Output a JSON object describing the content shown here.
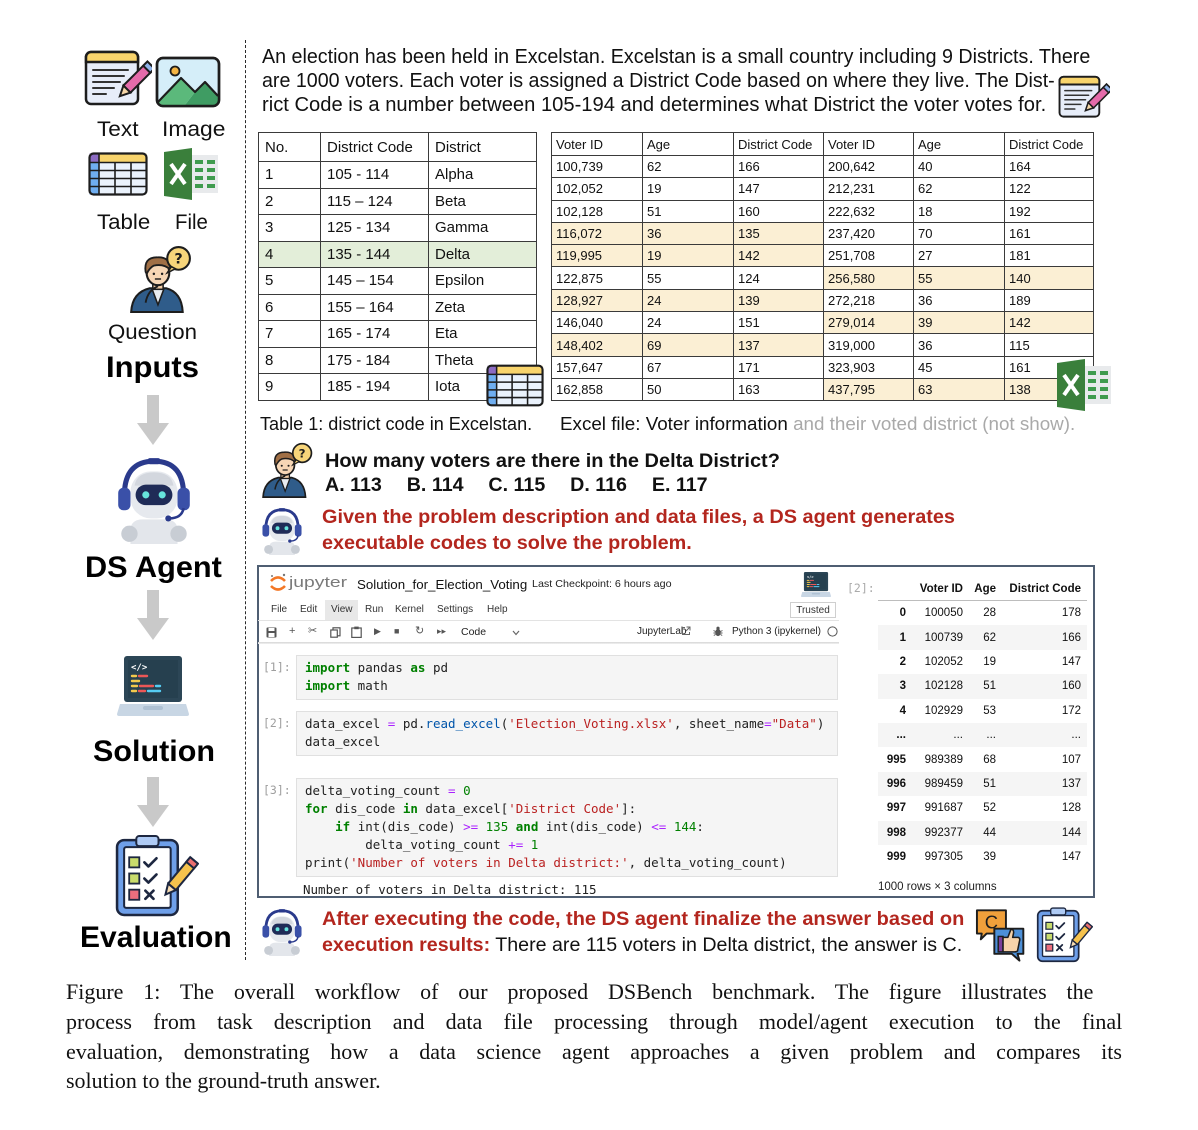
{
  "theme": {
    "accent_red": "#B3261E",
    "highlight_yellow": "#FBEFD4",
    "highlight_green": "#E3EED9",
    "arrow_gray": "#C9C9C9",
    "jupyter_orange": "#F37726"
  },
  "sidebar": {
    "input_types": [
      {
        "label": "Text",
        "icon": "text-icon"
      },
      {
        "label": "Image",
        "icon": "image-icon"
      },
      {
        "label": "Table",
        "icon": "table-icon"
      },
      {
        "label": "File",
        "icon": "excel-file-icon"
      }
    ],
    "question_label": "Question",
    "stages": [
      {
        "label": "Inputs"
      },
      {
        "label": "DS Agent",
        "icon": "robot-icon"
      },
      {
        "label": "Solution",
        "icon": "laptop-code-icon"
      },
      {
        "label": "Evaluation",
        "icon": "checklist-clipboard-icon"
      }
    ]
  },
  "description": {
    "lines": [
      "An election has been held in Excelstan. Excelstan is a small country including 9 Districts. There",
      "are 1000 voters. Each voter is assigned a District Code based on where they live. The Dist-",
      "rict Code is a number between 105-194 and determines what District the voter votes for."
    ]
  },
  "district_table": {
    "headers": [
      "No.",
      "District Code",
      "District"
    ],
    "rows": [
      {
        "no": "1",
        "code": "105 - 114",
        "district": "Alpha",
        "highlight": false
      },
      {
        "no": "2",
        "code": "115 – 124",
        "district": "Beta",
        "highlight": false
      },
      {
        "no": "3",
        "code": "125 - 134",
        "district": "Gamma",
        "highlight": false
      },
      {
        "no": "4",
        "code": "135 - 144",
        "district": "Delta",
        "highlight": true
      },
      {
        "no": "5",
        "code": "145 – 154",
        "district": "Epsilon",
        "highlight": false
      },
      {
        "no": "6",
        "code": "155 – 164",
        "district": "Zeta",
        "highlight": false
      },
      {
        "no": "7",
        "code": "165 - 174",
        "district": "Eta",
        "highlight": false
      },
      {
        "no": "8",
        "code": "175 - 184",
        "district": "Theta",
        "highlight": false
      },
      {
        "no": "9",
        "code": "185 - 194",
        "district": "Iota",
        "highlight": false
      }
    ]
  },
  "voter_file": {
    "headers": [
      "Voter ID",
      "Age",
      "District Code",
      "Voter ID",
      "Age",
      "District Code"
    ],
    "rows": [
      {
        "cells": [
          "100,739",
          "62",
          "166",
          "200,642",
          "40",
          "164"
        ],
        "highlight_left": false,
        "highlight_right": false
      },
      {
        "cells": [
          "102,052",
          "19",
          "147",
          "212,231",
          "62",
          "122"
        ],
        "highlight_left": false,
        "highlight_right": false
      },
      {
        "cells": [
          "102,128",
          "51",
          "160",
          "222,632",
          "18",
          "192"
        ],
        "highlight_left": false,
        "highlight_right": false
      },
      {
        "cells": [
          "116,072",
          "36",
          "135",
          "237,420",
          "70",
          "161"
        ],
        "highlight_left": true,
        "highlight_right": false
      },
      {
        "cells": [
          "119,995",
          "19",
          "142",
          "251,708",
          "27",
          "181"
        ],
        "highlight_left": true,
        "highlight_right": false
      },
      {
        "cells": [
          "122,875",
          "55",
          "124",
          "256,580",
          "55",
          "140"
        ],
        "highlight_left": false,
        "highlight_right": true
      },
      {
        "cells": [
          "128,927",
          "24",
          "139",
          "272,218",
          "36",
          "189"
        ],
        "highlight_left": true,
        "highlight_right": false
      },
      {
        "cells": [
          "146,040",
          "24",
          "151",
          "279,014",
          "39",
          "142"
        ],
        "highlight_left": false,
        "highlight_right": true
      },
      {
        "cells": [
          "148,402",
          "69",
          "137",
          "319,000",
          "36",
          "115"
        ],
        "highlight_left": true,
        "highlight_right": false
      },
      {
        "cells": [
          "157,647",
          "67",
          "171",
          "323,903",
          "45",
          "161"
        ],
        "highlight_left": false,
        "highlight_right": false
      },
      {
        "cells": [
          "162,858",
          "50",
          "163",
          "437,795",
          "63",
          "138"
        ],
        "highlight_left": false,
        "highlight_right": true
      }
    ]
  },
  "captions": {
    "table": "Table 1: district code in Excelstan.",
    "file_visible": "Excel file: Voter information",
    "file_hidden": " and their voted district (not show)."
  },
  "question": {
    "text": "How many voters are there in the Delta District?",
    "options": [
      "A. 113",
      "B. 114",
      "C. 115",
      "D. 116",
      "E. 117"
    ]
  },
  "agent_step": {
    "lines": [
      "Given the problem description and data files, a DS agent generates",
      "executable codes to solve the problem."
    ]
  },
  "jupyter": {
    "logo_text": "jupyter",
    "notebook_name": "Solution_for_Election_Voting",
    "checkpoint": "Last Checkpoint: 6 hours ago",
    "menu": [
      "File",
      "Edit",
      "View",
      "Run",
      "Kernel",
      "Settings",
      "Help"
    ],
    "active_menu": "View",
    "trusted": "Trusted",
    "toolbar": {
      "add": "+",
      "cut": "✂",
      "run": "▶",
      "stop": "■",
      "restart": "↻",
      "run_all": "▸▸",
      "cell_type": "Code",
      "lab_link": "JupyterLab",
      "kernel": "Python 3 (ipykernel)"
    },
    "cells": [
      {
        "prompt": "[1]:",
        "lines": [
          [
            {
              "text": "import",
              "type": "kw"
            },
            {
              "text": " pandas ",
              "type": "plain"
            },
            {
              "text": "as",
              "type": "kw"
            },
            {
              "text": " pd",
              "type": "plain"
            }
          ],
          [
            {
              "text": "import",
              "type": "kw"
            },
            {
              "text": " math",
              "type": "plain"
            }
          ]
        ]
      },
      {
        "prompt": "[2]:",
        "lines": [
          [
            {
              "text": "data_excel ",
              "type": "plain"
            },
            {
              "text": "=",
              "type": "op"
            },
            {
              "text": " pd.",
              "type": "plain"
            },
            {
              "text": "read_excel",
              "type": "fn"
            },
            {
              "text": "(",
              "type": "plain"
            },
            {
              "text": "'Election_Voting.xlsx'",
              "type": "str"
            },
            {
              "text": ", sheet_name",
              "type": "plain"
            },
            {
              "text": "=",
              "type": "op"
            },
            {
              "text": "\"Data\"",
              "type": "str"
            },
            {
              "text": ")",
              "type": "plain"
            }
          ],
          [
            {
              "text": "data_excel",
              "type": "plain"
            }
          ]
        ]
      },
      {
        "prompt": "[3]:",
        "lines": [
          [
            {
              "text": "delta_voting_count ",
              "type": "plain"
            },
            {
              "text": "=",
              "type": "op"
            },
            {
              "text": " ",
              "type": "plain"
            },
            {
              "text": "0",
              "type": "num"
            }
          ],
          [
            {
              "text": "for",
              "type": "kw"
            },
            {
              "text": " dis_code ",
              "type": "plain"
            },
            {
              "text": "in",
              "type": "kw"
            },
            {
              "text": " data_excel[",
              "type": "plain"
            },
            {
              "text": "'District Code'",
              "type": "str"
            },
            {
              "text": "]:",
              "type": "plain"
            }
          ],
          [
            {
              "text": "    ",
              "type": "plain"
            },
            {
              "text": "if",
              "type": "kw"
            },
            {
              "text": " int(dis_code) ",
              "type": "plain"
            },
            {
              "text": ">=",
              "type": "op"
            },
            {
              "text": " ",
              "type": "plain"
            },
            {
              "text": "135",
              "type": "num"
            },
            {
              "text": " ",
              "type": "plain"
            },
            {
              "text": "and",
              "type": "kw"
            },
            {
              "text": " int(dis_code) ",
              "type": "plain"
            },
            {
              "text": "<=",
              "type": "op"
            },
            {
              "text": " ",
              "type": "plain"
            },
            {
              "text": "144",
              "type": "num"
            },
            {
              "text": ":",
              "type": "plain"
            }
          ],
          [
            {
              "text": "        delta_voting_count ",
              "type": "plain"
            },
            {
              "text": "+=",
              "type": "op"
            },
            {
              "text": " ",
              "type": "plain"
            },
            {
              "text": "1",
              "type": "num"
            }
          ],
          [
            {
              "text": "print(",
              "type": "plain"
            },
            {
              "text": "'Number of voters in Delta district:'",
              "type": "str"
            },
            {
              "text": ", delta_voting_count)",
              "type": "plain"
            }
          ]
        ],
        "output": "Number of voters in Delta district: 115"
      }
    ],
    "dataframe_output": {
      "prompt": "[2]:",
      "columns": [
        "",
        "Voter ID",
        "Age",
        "District Code"
      ],
      "rows": [
        [
          "0",
          "100050",
          "28",
          "178"
        ],
        [
          "1",
          "100739",
          "62",
          "166"
        ],
        [
          "2",
          "102052",
          "19",
          "147"
        ],
        [
          "3",
          "102128",
          "51",
          "160"
        ],
        [
          "4",
          "102929",
          "53",
          "172"
        ],
        [
          "...",
          "...",
          "...",
          "..."
        ],
        [
          "995",
          "989389",
          "68",
          "107"
        ],
        [
          "996",
          "989459",
          "51",
          "137"
        ],
        [
          "997",
          "991687",
          "52",
          "128"
        ],
        [
          "998",
          "992377",
          "44",
          "144"
        ],
        [
          "999",
          "997305",
          "39",
          "147"
        ]
      ],
      "footer": "1000 rows × 3 columns"
    }
  },
  "result": {
    "line1": "After executing the code, the DS agent finalize the answer based on",
    "line2_label": "execution results:",
    "line2_text": " There are 115 voters in Delta district, the answer is C.",
    "answer_badge": "C"
  },
  "figure_caption": {
    "lines": [
      "Figure 1:  The overall workflow of our proposed DSBench benchmark.  The figure illustrates the",
      "process from task description and data file processing through model/agent execution to the final",
      "evaluation, demonstrating how a data science agent approaches a given problem and compares its",
      "solution to the ground-truth answer."
    ]
  }
}
